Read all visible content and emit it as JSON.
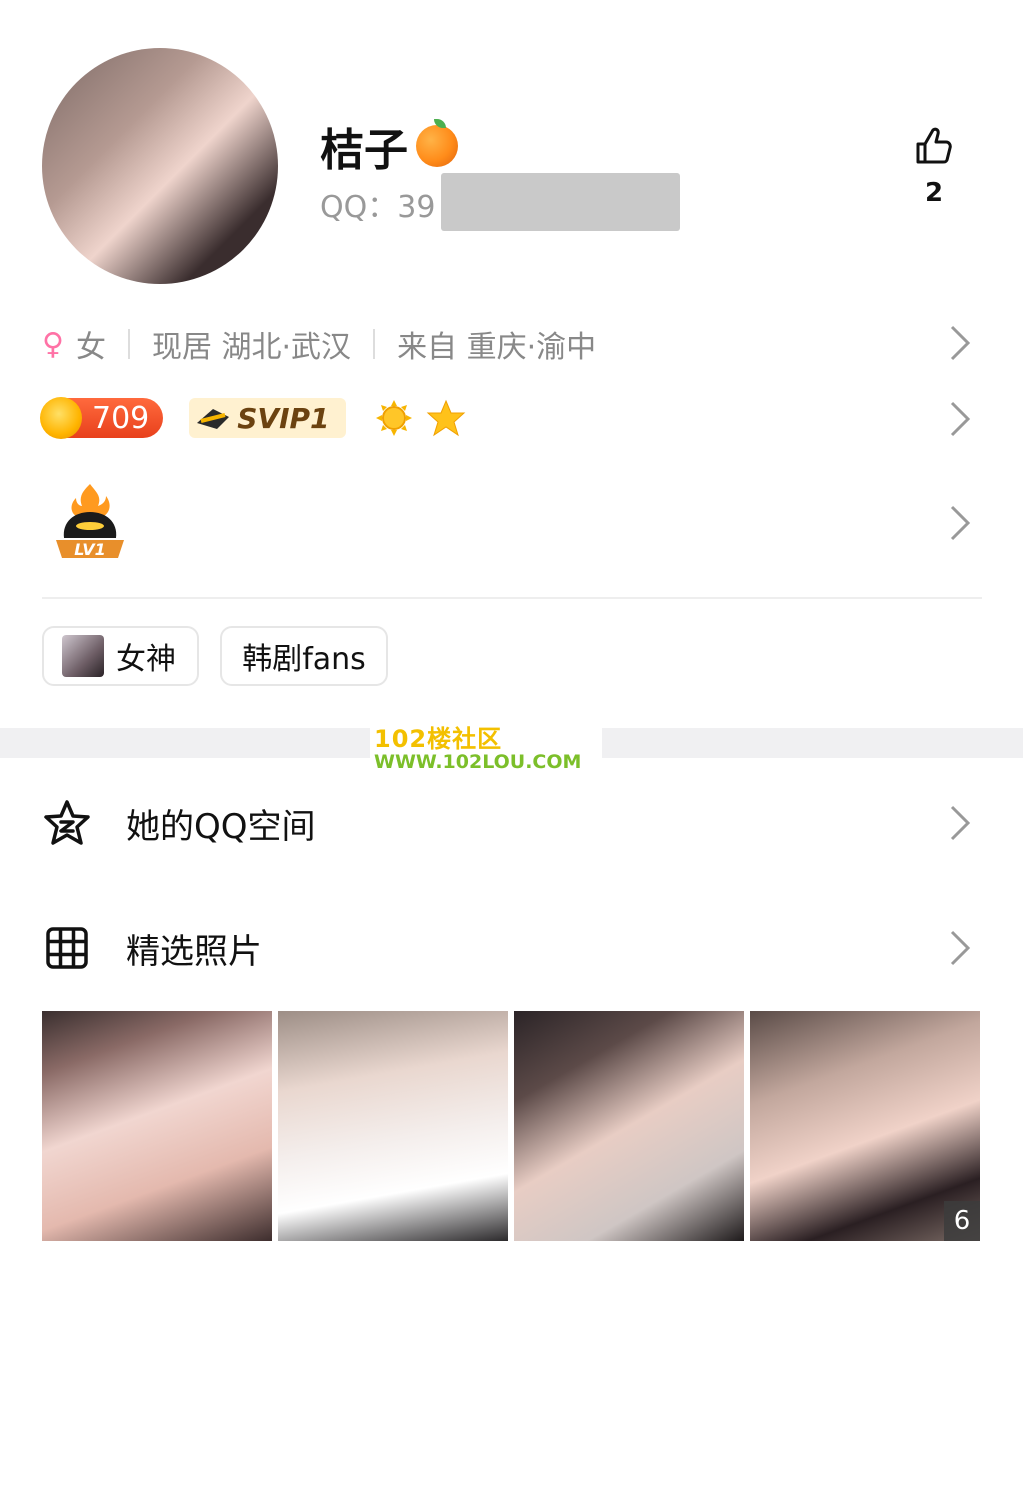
{
  "profile": {
    "nickname": "桔子",
    "qq_label": "QQ：39",
    "like_count": "2"
  },
  "info": {
    "gender_symbol": "♀",
    "gender": "女",
    "residence": "现居 湖北·武汉",
    "hometown": "来自 重庆·渝中"
  },
  "badges": {
    "coin_value": "709",
    "svip_label": "SVIP1"
  },
  "level": {
    "label": "LV1"
  },
  "tags": [
    {
      "label": "女神"
    },
    {
      "label": "韩剧fans"
    }
  ],
  "watermark": {
    "line1": "102楼社区",
    "line2": "WWW.102LOU.COM"
  },
  "menu": {
    "qzone_label": "她的QQ空间",
    "photos_label": "精选照片"
  },
  "photos": {
    "count": "6"
  },
  "colors": {
    "accent_female": "#ff72a6",
    "coin_badge": "#e8401c",
    "svip_bg": "#fff1d0",
    "separator": "#f0f0f2"
  }
}
